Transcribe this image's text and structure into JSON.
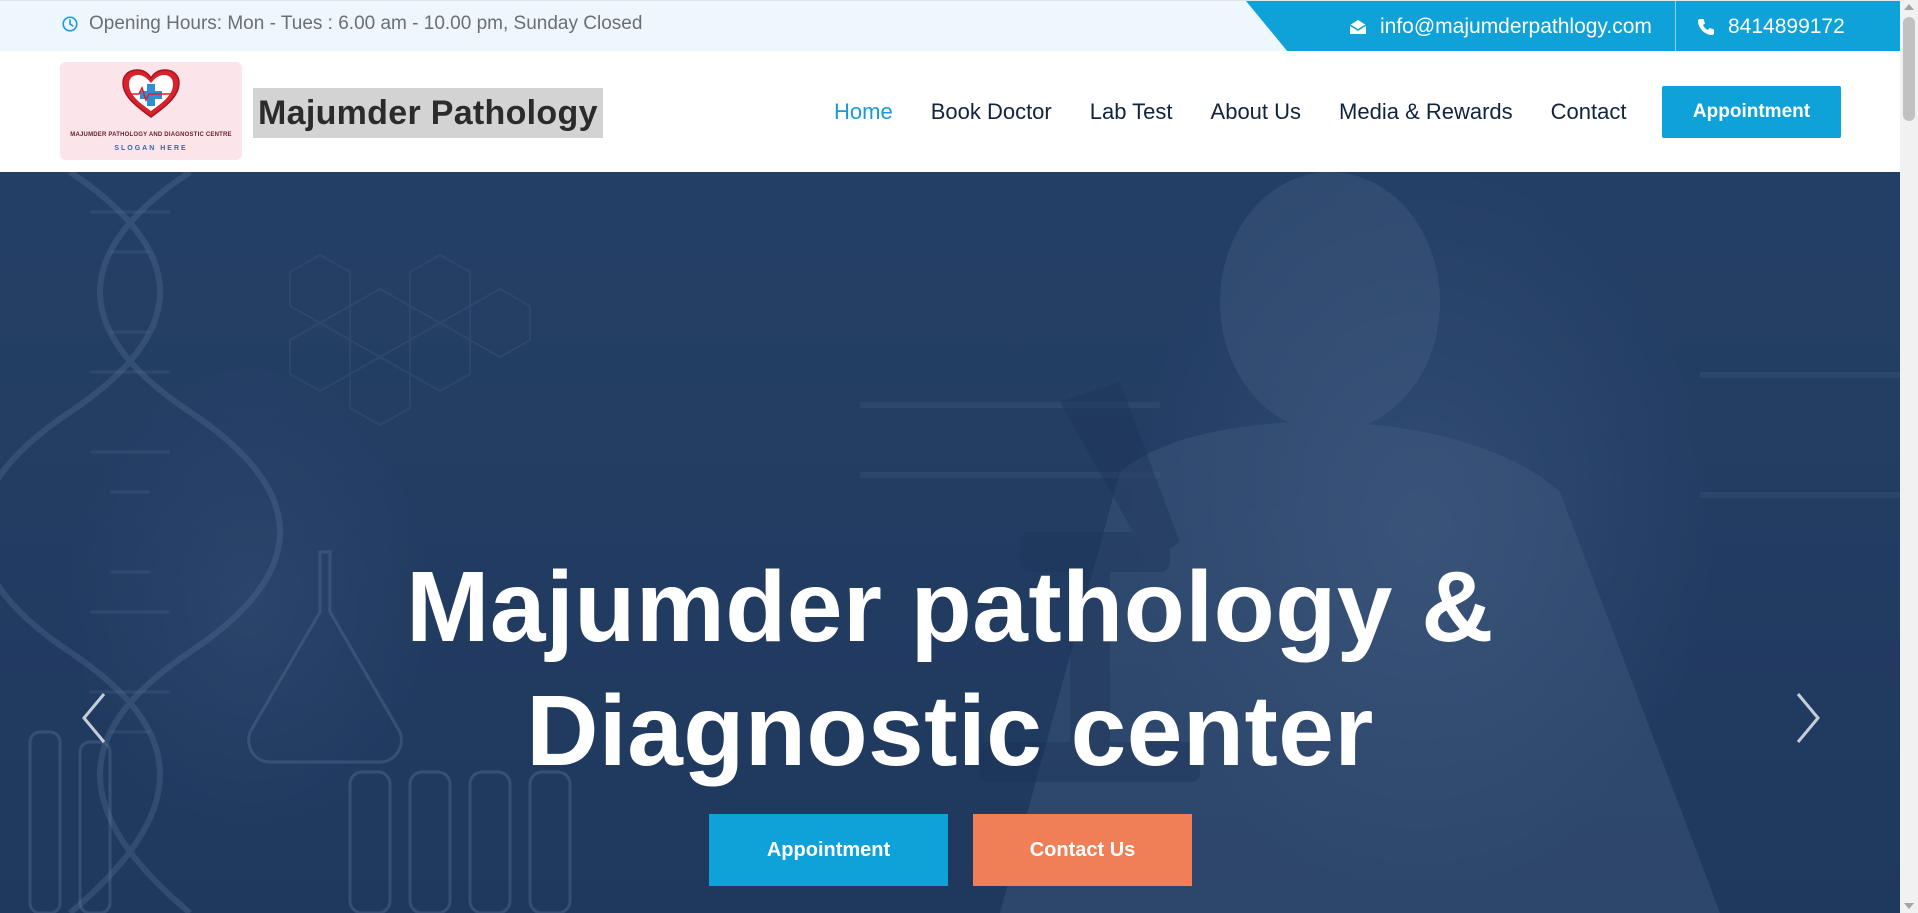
{
  "topbar": {
    "hours_text": "Opening Hours: Mon - Tues : 6.00 am - 10.00 pm, Sunday Closed",
    "hours_icon": "clock-icon",
    "email": "info@majumderpathlogy.com",
    "email_icon": "envelope-icon",
    "phone": "8414899172",
    "phone_icon": "phone-icon"
  },
  "brand": {
    "logo_line1": "MAJUMDER PATHOLOGY AND DIAGNOSTIC CENTRE",
    "logo_line2": "SLOGAN HERE",
    "name": "Majumder Pathology"
  },
  "nav": {
    "items": [
      {
        "label": "Home",
        "active": true
      },
      {
        "label": "Book Doctor",
        "active": false
      },
      {
        "label": "Lab Test",
        "active": false
      },
      {
        "label": "About Us",
        "active": false
      },
      {
        "label": "Media & Rewards",
        "active": false
      },
      {
        "label": "Contact",
        "active": false
      }
    ],
    "appointment_label": "Appointment"
  },
  "hero": {
    "title_line1": "Majumder pathology &",
    "title_line2": "Diagnostic center",
    "appointment_label": "Appointment",
    "contact_label": "Contact Us",
    "prev_icon": "chevron-left-icon",
    "next_icon": "chevron-right-icon"
  },
  "colors": {
    "primary": "#0fa2d8",
    "accent": "#f07f57",
    "nav_text": "#12233e",
    "topbar_bg": "#eef7fd"
  }
}
